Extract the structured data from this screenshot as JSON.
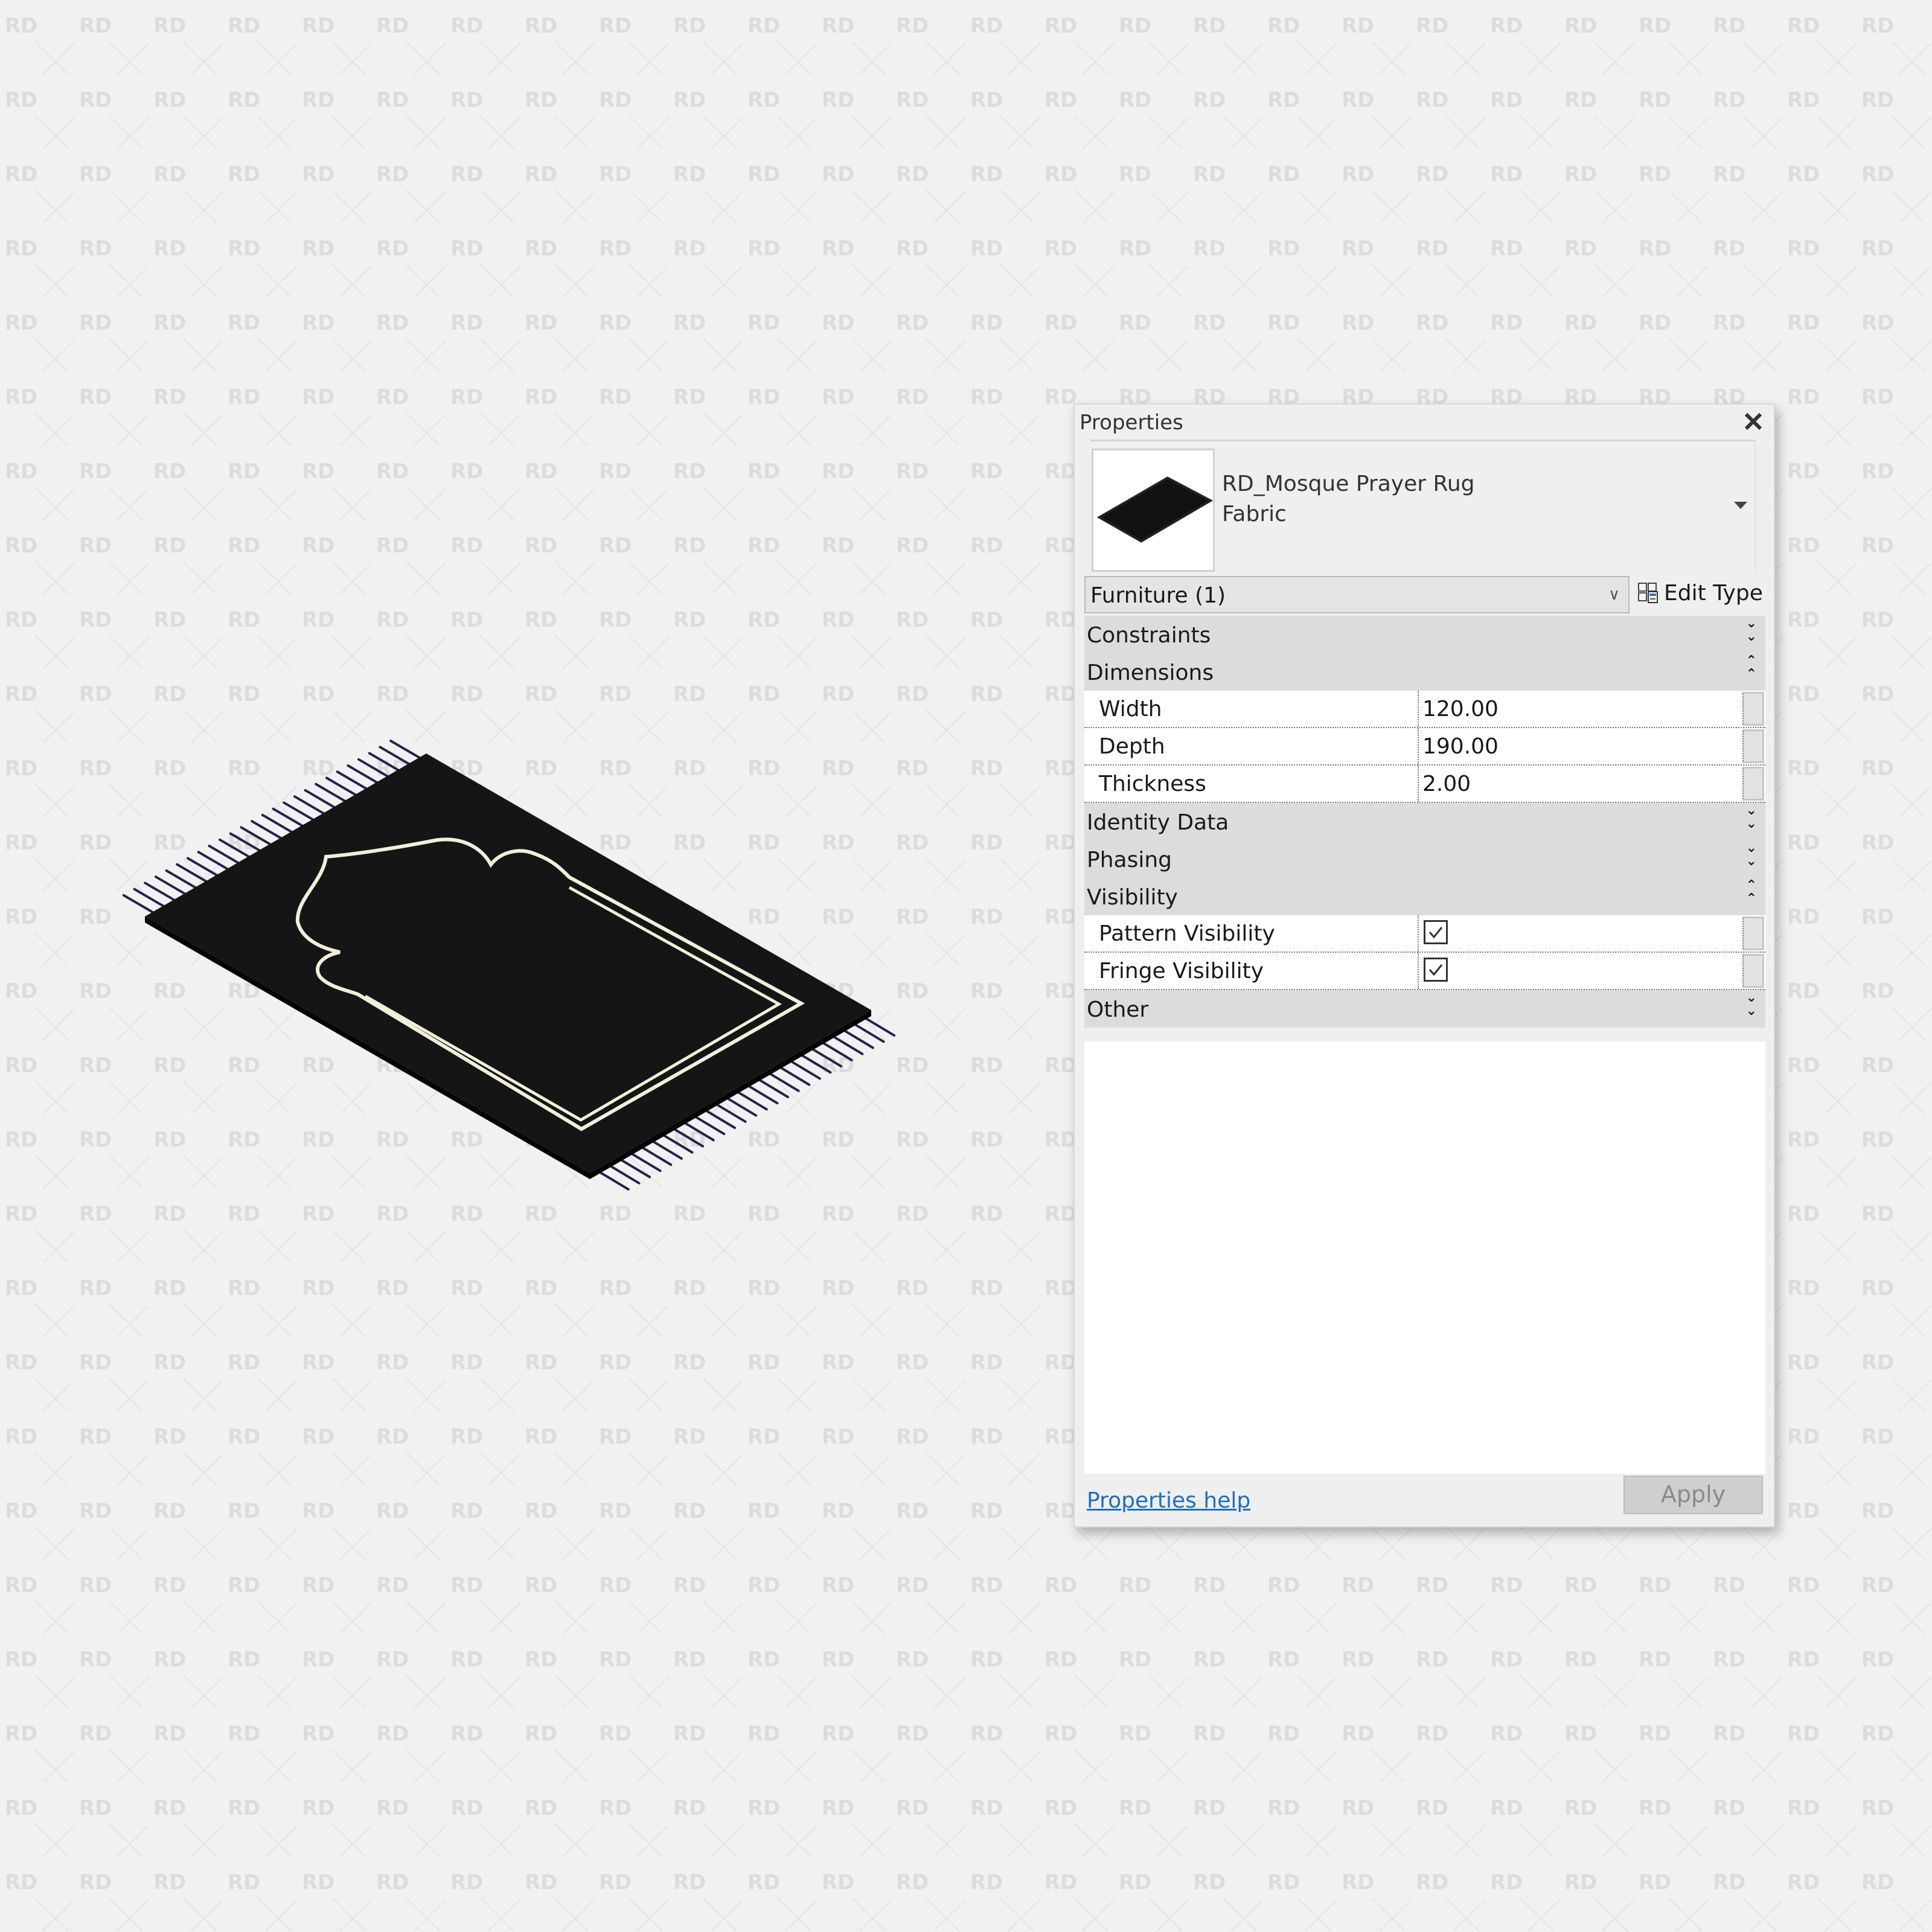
{
  "background": {
    "watermark_text": "RD",
    "color": "#f1f1f1",
    "watermark_color": "#dcdcdc"
  },
  "viewport": {
    "model": "prayer-rug",
    "colors": {
      "rug": "#151515",
      "rug_edge": "#050505",
      "border_lines": "#f1efd9",
      "fringe": "#23234f"
    }
  },
  "properties_panel": {
    "title": "Properties",
    "close_icon": "close-icon",
    "type_selector": {
      "family": "RD_Mosque Prayer Rug",
      "type": "Fabric",
      "dropdown_icon": "triangle-down-icon"
    },
    "instance_filter": {
      "value": "Furniture (1)",
      "chevron": "chevron-down-icon"
    },
    "edit_type": {
      "label": "Edit Type",
      "icon": "edit-type-icon"
    },
    "groups": [
      {
        "name": "Constraints",
        "expanded": false,
        "toggle": "»"
      },
      {
        "name": "Dimensions",
        "expanded": true,
        "toggle": "«",
        "rows": [
          {
            "name": "Width",
            "value": "120.00"
          },
          {
            "name": "Depth",
            "value": "190.00"
          },
          {
            "name": "Thickness",
            "value": "2.00"
          }
        ]
      },
      {
        "name": "Identity Data",
        "expanded": false,
        "toggle": "»"
      },
      {
        "name": "Phasing",
        "expanded": false,
        "toggle": "»"
      },
      {
        "name": "Visibility",
        "expanded": true,
        "toggle": "«",
        "rows": [
          {
            "name": "Pattern Visibility",
            "checked": true
          },
          {
            "name": "Fringe Visibility",
            "checked": true
          }
        ]
      },
      {
        "name": "Other",
        "expanded": false,
        "toggle": "»"
      }
    ],
    "help_link": "Properties help",
    "apply_label": "Apply",
    "colors": {
      "link": "#1b6fc8",
      "group_header": "#dcdcdc",
      "panel": "#efefef"
    }
  }
}
